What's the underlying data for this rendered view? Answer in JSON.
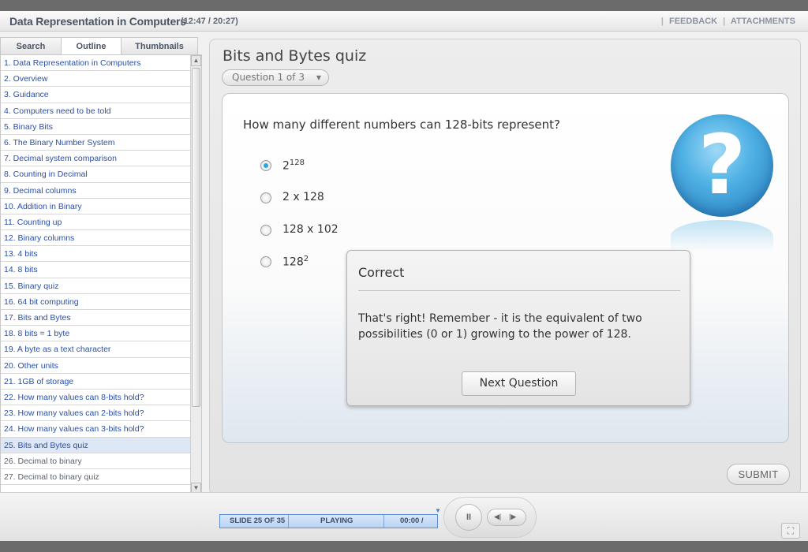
{
  "header": {
    "title": "Data Representation in Computers",
    "time": "(12:47 / 20:27)",
    "links": [
      "FEEDBACK",
      "ATTACHMENTS"
    ]
  },
  "sidebar": {
    "tabs": [
      "Search",
      "Outline",
      "Thumbnails"
    ],
    "active_tab": "Outline",
    "items": [
      {
        "label": "1. Data Representation in Computers"
      },
      {
        "label": "2. Overview"
      },
      {
        "label": "3. Guidance"
      },
      {
        "label": "4. Computers need to be told"
      },
      {
        "label": "5. Binary Bits"
      },
      {
        "label": "6. The Binary Number System"
      },
      {
        "label": "7. Decimal system comparison"
      },
      {
        "label": "8. Counting in Decimal"
      },
      {
        "label": "9. Decimal columns"
      },
      {
        "label": "10. Addition in Binary"
      },
      {
        "label": "11. Counting up"
      },
      {
        "label": "12. Binary columns"
      },
      {
        "label": "13. 4 bits"
      },
      {
        "label": "14. 8 bits"
      },
      {
        "label": "15. Binary quiz"
      },
      {
        "label": "16. 64 bit computing"
      },
      {
        "label": "17. Bits and Bytes"
      },
      {
        "label": "18. 8 bits = 1 byte"
      },
      {
        "label": "19. A byte as a text character"
      },
      {
        "label": "20. Other units"
      },
      {
        "label": "21. 1GB of storage"
      },
      {
        "label": "22. How many values can 8-bits hold?"
      },
      {
        "label": "23. How many values can 2-bits hold?"
      },
      {
        "label": "24. How many values can 3-bits hold?"
      },
      {
        "label": "25. Bits and Bytes quiz"
      },
      {
        "label": "26. Decimal to binary"
      },
      {
        "label": "27. Decimal to binary quiz"
      }
    ],
    "current_index": 24
  },
  "quiz": {
    "title": "Bits and Bytes quiz",
    "question_selector": "Question 1 of 3",
    "question": "How many different numbers can 128-bits represent?",
    "options": [
      {
        "base": "2",
        "sup": "128",
        "checked": true
      },
      {
        "base": "2 x 128",
        "sup": "",
        "checked": false
      },
      {
        "base": "128 x 102",
        "sup": "",
        "checked": false
      },
      {
        "base": "128",
        "sup": "2",
        "checked": false
      }
    ],
    "icon": "question-mark-icon"
  },
  "feedback": {
    "title": "Correct",
    "message": "That's right! Remember - it is the equivalent of two possibilities (0 or 1) growing to the power of 128.",
    "button": "Next Question"
  },
  "submit_label": "SUBMIT",
  "player": {
    "slide": "SLIDE 25 OF 35",
    "state": "PLAYING",
    "elapsed": "00:00 /",
    "pause_glyph": "II",
    "prev_glyph": "◀|",
    "next_glyph": "|▶"
  },
  "colors": {
    "link": "#2a4fa8",
    "accent": "#2aa6d8",
    "current_row": "#dde7f5"
  }
}
